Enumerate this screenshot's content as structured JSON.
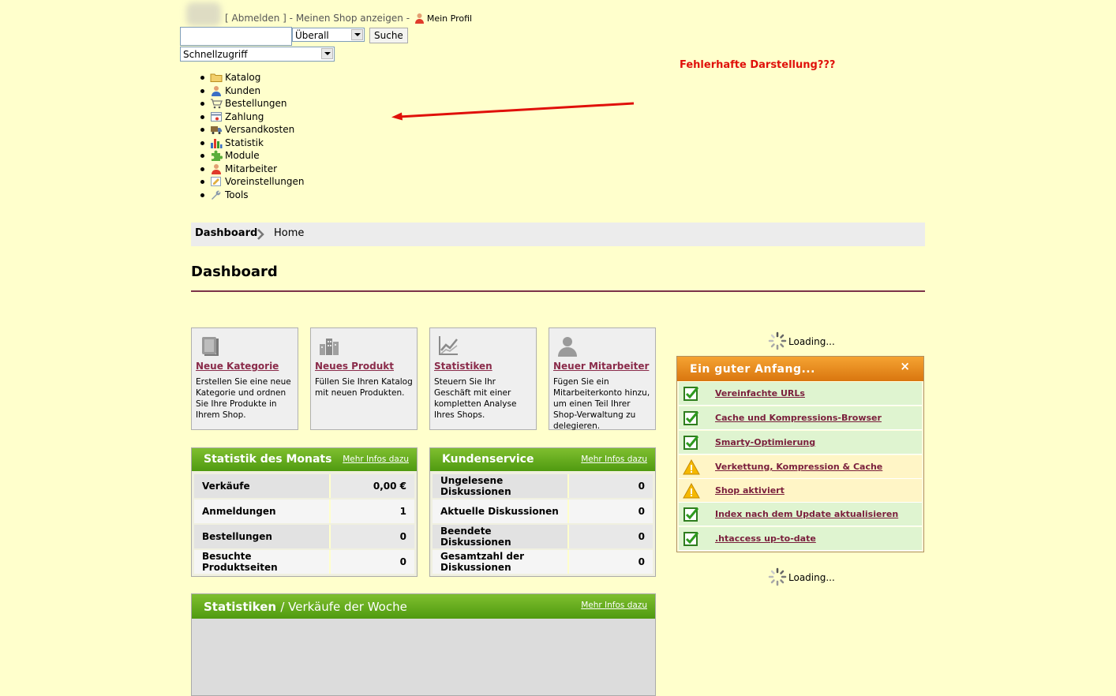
{
  "header": {
    "logout_link": "[ Abmelden ]",
    "separator1": " - ",
    "shop_link": "Meinen Shop anzeigen",
    "separator2": " - ",
    "profile_link": "Mein Profil",
    "search": {
      "value": "",
      "scope": "Überall",
      "button": "Suche"
    },
    "quick_access": "Schnellzugriff"
  },
  "menu": [
    {
      "label": "Katalog",
      "icon": "folder-icon"
    },
    {
      "label": "Kunden",
      "icon": "customer-icon"
    },
    {
      "label": "Bestellungen",
      "icon": "cart-icon"
    },
    {
      "label": "Zahlung",
      "icon": "payment-icon"
    },
    {
      "label": "Versandkosten",
      "icon": "truck-icon"
    },
    {
      "label": "Statistik",
      "icon": "bar-chart-icon"
    },
    {
      "label": "Module",
      "icon": "puzzle-icon"
    },
    {
      "label": "Mitarbeiter",
      "icon": "employee-icon"
    },
    {
      "label": "Voreinstellungen",
      "icon": "preferences-icon"
    },
    {
      "label": "Tools",
      "icon": "wrench-icon"
    }
  ],
  "annotation": "Fehlerhafte Darstellung???",
  "breadcrumb": {
    "first": "Dashboard",
    "second": "Home"
  },
  "page_title": "Dashboard",
  "tiles": [
    {
      "title": "Neue Kategorie",
      "desc": "Erstellen Sie eine neue Kategorie und ordnen Sie Ihre Produkte in Ihrem Shop.",
      "icon": "book-icon"
    },
    {
      "title": "Neues Produkt",
      "desc": "Füllen Sie Ihren Katalog mit neuen Produkten.",
      "icon": "buildings-icon"
    },
    {
      "title": "Statistiken",
      "desc": "Steuern Sie Ihr Geschäft mit einer kompletten Analyse Ihres Shops.",
      "icon": "line-chart-icon"
    },
    {
      "title": "Neuer Mitarbeiter",
      "desc": "Fügen Sie ein Mitarbeiterkonto hinzu, um einen Teil Ihrer Shop-Verwaltung zu delegieren.",
      "icon": "person-silhouette-icon"
    }
  ],
  "month_stats": {
    "title": "Statistik des Monats",
    "more": "Mehr Infos dazu",
    "rows": [
      {
        "label": "Verkäufe",
        "value": "0,00 €"
      },
      {
        "label": "Anmeldungen",
        "value": "1"
      },
      {
        "label": "Bestellungen",
        "value": "0"
      },
      {
        "label": "Besuchte Produktseiten",
        "value": "0"
      }
    ]
  },
  "customer_service": {
    "title": "Kundenservice",
    "more": "Mehr Infos dazu",
    "rows": [
      {
        "label": "Ungelesene Diskussionen",
        "value": "0"
      },
      {
        "label": "Aktuelle Diskussionen",
        "value": "0"
      },
      {
        "label": "Beendete Diskussionen",
        "value": "0"
      },
      {
        "label": "Gesamtzahl der Diskussionen",
        "value": "0"
      }
    ]
  },
  "week_stats": {
    "title": "Statistiken",
    "subtitle": "/ Verkäufe der Woche",
    "more": "Mehr Infos dazu"
  },
  "loading": "Loading...",
  "good_start": {
    "title": "Ein guter Anfang...",
    "close": "×",
    "items": [
      {
        "label": "Vereinfachte URLs",
        "status": "ok"
      },
      {
        "label": "Cache und Kompressions-Browser",
        "status": "ok"
      },
      {
        "label": "Smarty-Optimierung",
        "status": "ok"
      },
      {
        "label": "Verkettung, Kompression & Cache",
        "status": "warning"
      },
      {
        "label": "Shop aktiviert",
        "status": "warning"
      },
      {
        "label": "Index nach dem Update aktualisieren",
        "status": "ok"
      },
      {
        "label": ".htaccess up-to-date",
        "status": "ok"
      }
    ]
  },
  "colors": {
    "background": "#ffffcc",
    "panel_green": "#5aa41a",
    "panel_orange": "#e88a1e",
    "annotation_red": "#e0100a",
    "link": "#8a2b4a"
  }
}
